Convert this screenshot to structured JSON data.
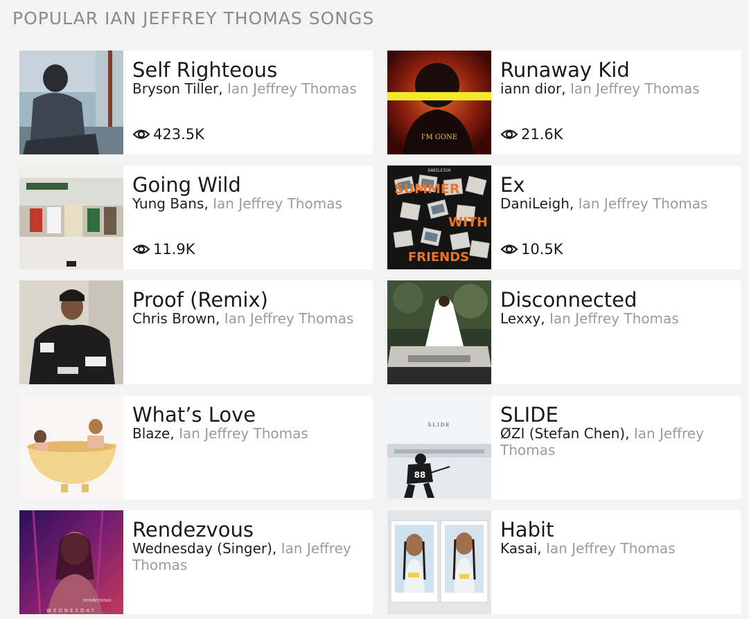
{
  "section_title": "POPULAR IAN JEFFREY THOMAS SONGS",
  "songs": [
    {
      "title": "Self Righteous",
      "primary_artist": "Bryson Tiller,",
      "featured_artist": "Ian Jeffrey Thomas",
      "views": "423.5K"
    },
    {
      "title": "Runaway Kid",
      "primary_artist": "iann dior,",
      "featured_artist": "Ian Jeffrey Thomas",
      "views": "21.6K"
    },
    {
      "title": "Going Wild",
      "primary_artist": "Yung Bans,",
      "featured_artist": "Ian Jeffrey Thomas",
      "views": "11.9K"
    },
    {
      "title": "Ex",
      "primary_artist": "DaniLeigh,",
      "featured_artist": "Ian Jeffrey Thomas",
      "views": "10.5K"
    },
    {
      "title": "Proof (Remix)",
      "primary_artist": "Chris Brown,",
      "featured_artist": "Ian Jeffrey Thomas"
    },
    {
      "title": "Disconnected",
      "primary_artist": "Lexxy,",
      "featured_artist": "Ian Jeffrey Thomas"
    },
    {
      "title": "What’s Love",
      "primary_artist": "Blaze,",
      "featured_artist": "Ian Jeffrey Thomas"
    },
    {
      "title": "SLIDE",
      "primary_artist": "ØZI (Stefan Chen),",
      "featured_artist": "Ian Jeffrey Thomas"
    },
    {
      "title": "Rendezvous",
      "primary_artist": "Wednesday (Singer),",
      "featured_artist": "Ian Jeffrey Thomas"
    },
    {
      "title": "Habit",
      "primary_artist": "Kasai,",
      "featured_artist": "Ian Jeffrey Thomas"
    }
  ],
  "cover_texts": {
    "runaway": "I'M GONE",
    "ex_artist": "DANILEIGH",
    "ex_line1": "SUMMER",
    "ex_line2": "WITH",
    "ex_line3": "FRIENDS",
    "slide": "SLIDE",
    "jersey": "88",
    "rendezvous_script": "rendezvous",
    "rendezvous_artist": "WEDNESDAY"
  },
  "icons": {
    "views": "eye-icon"
  },
  "colors": {
    "page_bg": "#f3f3f3",
    "card_bg": "#ffffff",
    "title": "#1a1a1a",
    "featured": "#9b9b9b",
    "section_title": "#8a8a8a"
  }
}
